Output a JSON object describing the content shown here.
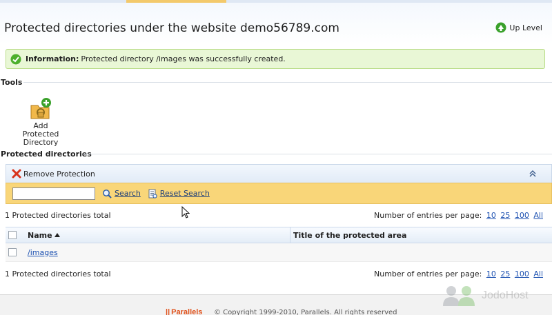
{
  "header": {
    "title": "Protected directories under the website demo56789.com",
    "up_level_label": "Up Level"
  },
  "info": {
    "label": "Information:",
    "message": "Protected directory /images was successfully created."
  },
  "tools": {
    "section_title": "Tools",
    "items": [
      {
        "label_line1": "Add Protected",
        "label_line2": "Directory",
        "icon": "add-protected-directory-icon"
      }
    ]
  },
  "list": {
    "section_title": "Protected directories",
    "toolbar": {
      "remove_label": "Remove Protection"
    },
    "search": {
      "value": "",
      "placeholder": "",
      "search_label": "Search",
      "reset_label": "Reset Search"
    },
    "total_top": "1 Protected directories total",
    "total_bottom": "1 Protected directories total",
    "per_page_label": "Number of entries per page:",
    "per_page_options": [
      "10",
      "25",
      "100",
      "All"
    ],
    "columns": [
      "Name",
      "Title of the protected area"
    ],
    "rows": [
      {
        "name": "/images",
        "title": ""
      }
    ]
  },
  "footer": {
    "logo": "Parallels",
    "copyright": "© Copyright 1999-2010, Parallels. All rights reserved"
  },
  "watermark": {
    "text": "JodoHost"
  },
  "colors": {
    "info_bg": "#e9f7d6",
    "search_bar_bg": "#f9d679",
    "link": "#1a4fb0",
    "brand_orange": "#e0521c"
  }
}
